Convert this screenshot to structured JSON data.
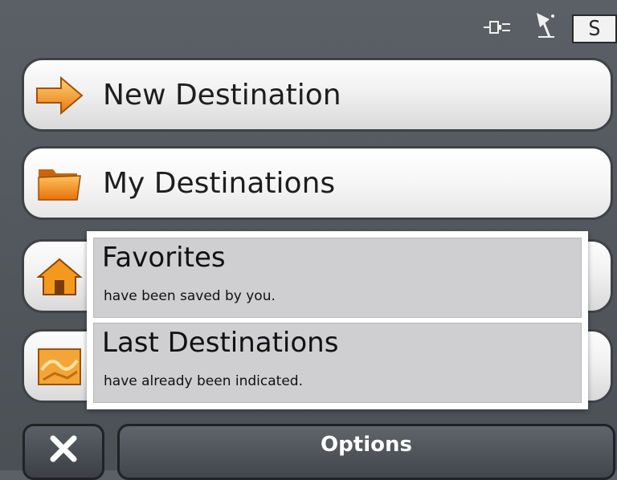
{
  "status": {
    "gps_badge": "S",
    "icons": [
      "power-plug-icon",
      "satellite-icon"
    ]
  },
  "menu": {
    "new_destination": "New Destination",
    "my_destinations": "My Destinations"
  },
  "popup": {
    "items": [
      {
        "title": "Favorites",
        "subtitle": "have been saved by you."
      },
      {
        "title": "Last Destinations",
        "subtitle": "have already been indicated."
      }
    ]
  },
  "bottom": {
    "options_label": "Options",
    "close_icon": "close-icon"
  },
  "colors": {
    "accent_orange": "#f39a1e",
    "background": "#52575c",
    "popup_item": "#cfcfd1"
  }
}
